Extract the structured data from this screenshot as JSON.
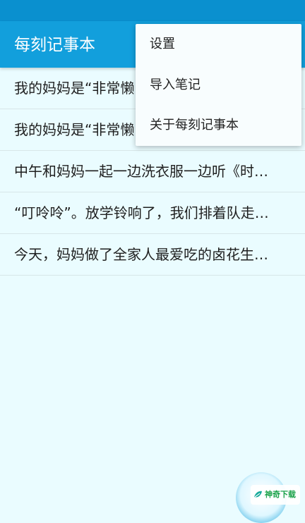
{
  "app": {
    "title": "每刻记事本"
  },
  "notes": [
    {
      "text": "我的妈妈是“非常懒"
    },
    {
      "text": "我的妈妈是“非常懒"
    },
    {
      "text": "中午和妈妈一起一边洗衣服一边听《时…"
    },
    {
      "text": "“叮呤呤”。放学铃响了，我们排着队走…"
    },
    {
      "text": "今天，妈妈做了全家人最爱吃的卤花生…"
    }
  ],
  "menu": {
    "items": [
      {
        "label": "设置"
      },
      {
        "label": "导入笔记"
      },
      {
        "label": "关于每刻记事本"
      }
    ]
  },
  "watermark": {
    "text": "神奇下载",
    "icon": "leaf-icon"
  },
  "colors": {
    "app_bar": "#129fdc",
    "status_bar": "#0a90cf",
    "background": "#eafcff",
    "menu_background": "#f8fdfe"
  }
}
